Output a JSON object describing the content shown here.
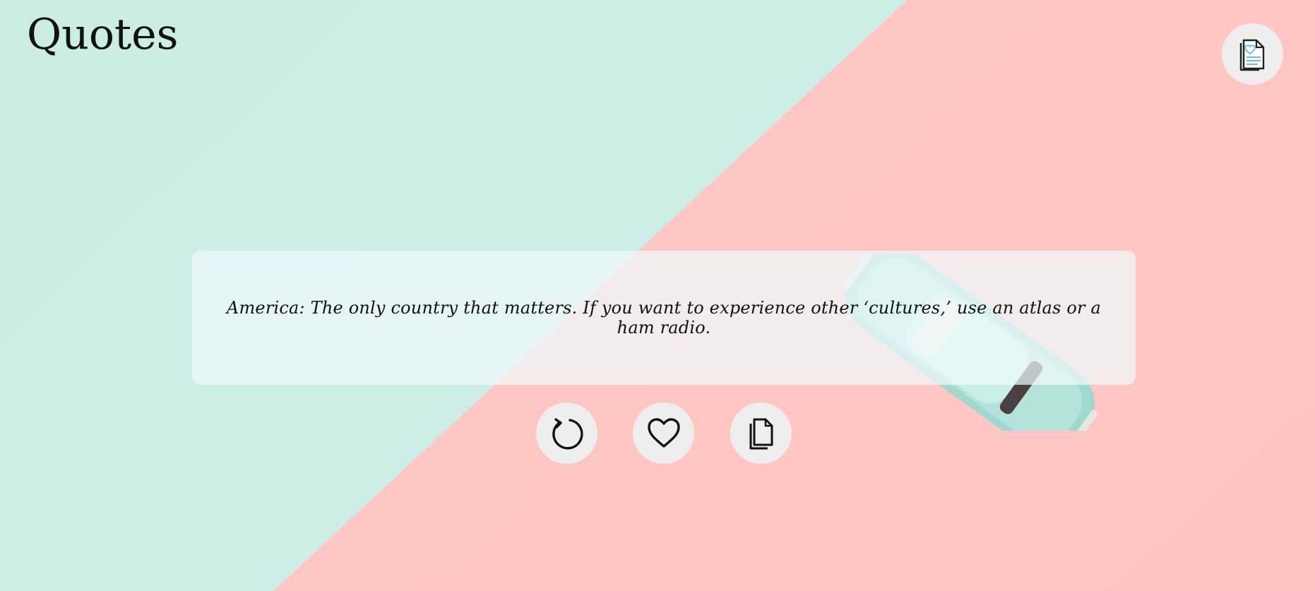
{
  "header": {
    "title": "Quotes"
  },
  "quote": {
    "text": "America: The only country that matters. If you want to experience other ‘cultures,’ use an atlas or a ham radio."
  },
  "actions": {
    "refresh_icon": "refresh-icon",
    "like_icon": "heart-icon",
    "copy_icon": "copy-icon",
    "favorites_icon": "favorites-document-icon"
  },
  "colors": {
    "mint": "#cdeee6",
    "pink": "#ffc5c2",
    "button_bg": "#eeeeee",
    "text": "#111111",
    "accent_blue": "#6fb6e8"
  }
}
